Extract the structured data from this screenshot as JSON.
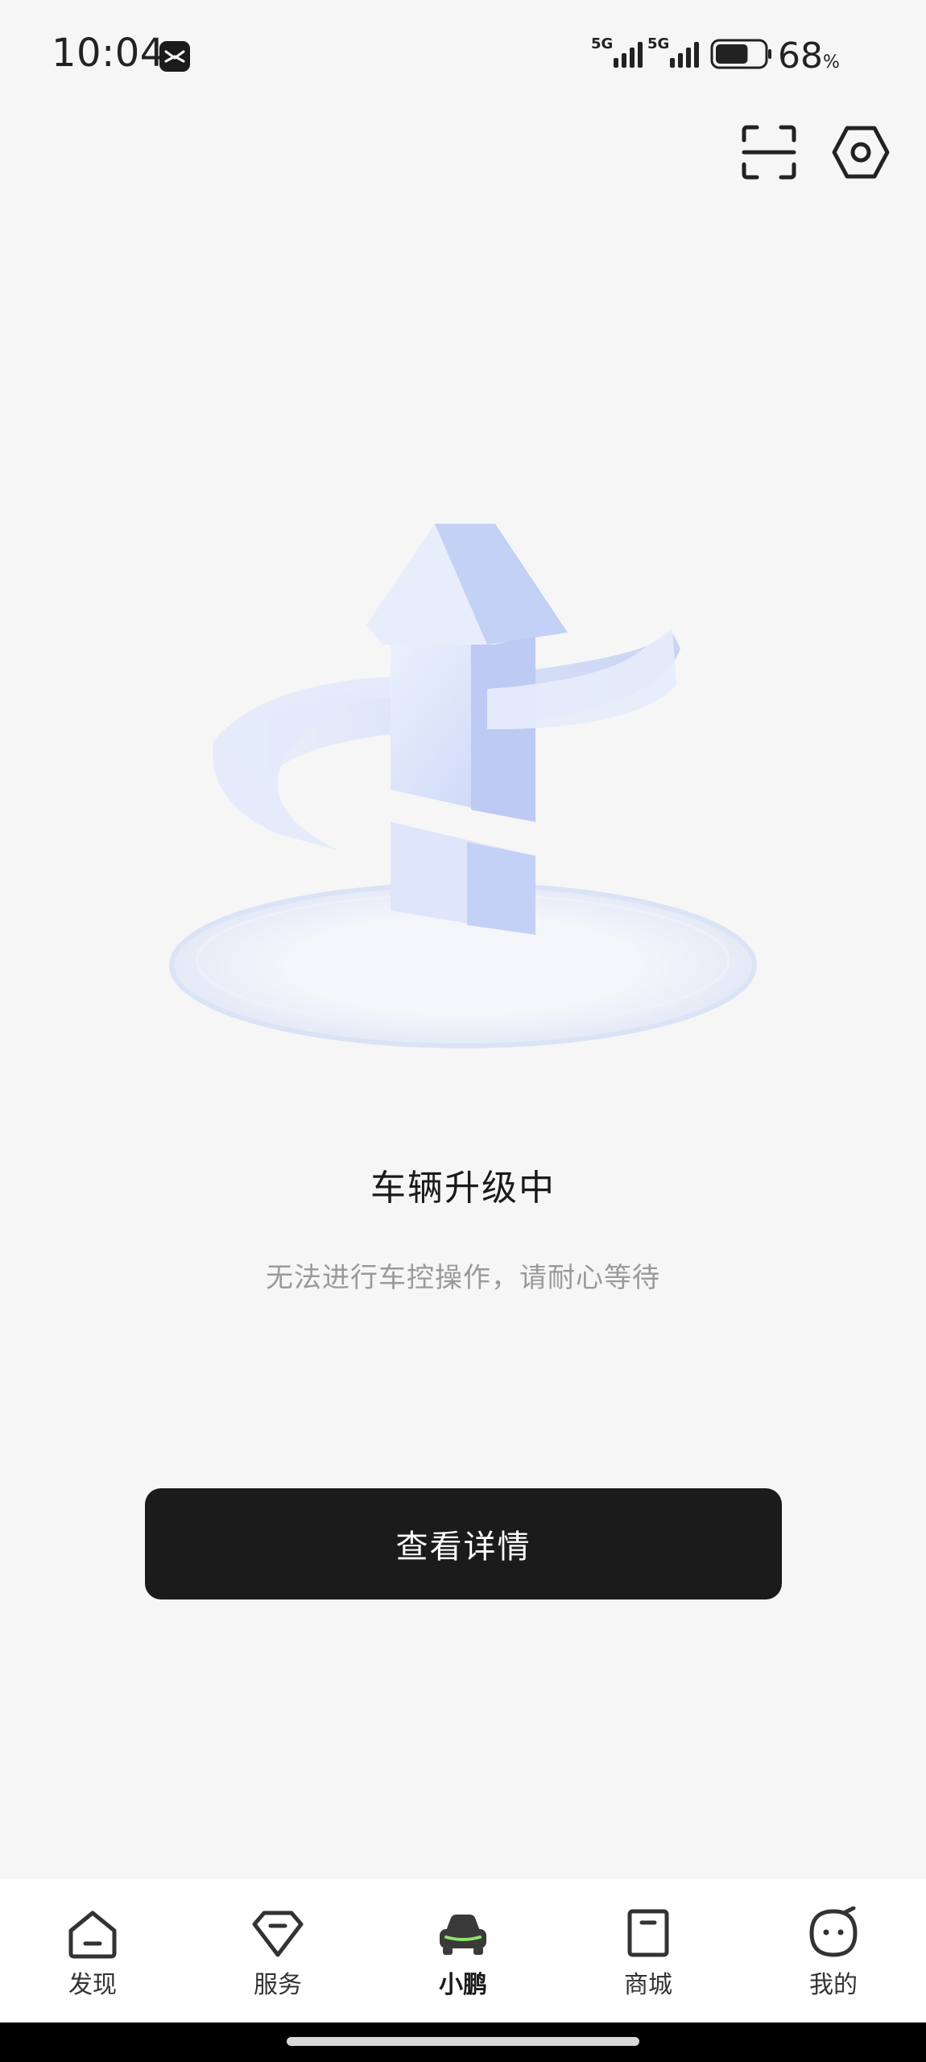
{
  "status_bar": {
    "time": "10:04",
    "app_icon": "xpeng-notification-icon",
    "network1": "5G",
    "network2": "5G",
    "battery_percent": "68",
    "battery_unit": "%",
    "battery_level": 0.68
  },
  "top_actions": {
    "scan_icon": "scan-icon",
    "settings_icon": "hexagon-settings-icon"
  },
  "status": {
    "title": "车辆升级中",
    "message": "无法进行车控操作，请耐心等待",
    "button_label": "查看详情"
  },
  "tabs": [
    {
      "label": "发现",
      "icon": "discover-icon",
      "active": false
    },
    {
      "label": "服务",
      "icon": "service-icon",
      "active": false
    },
    {
      "label": "小鹏",
      "icon": "car-icon",
      "active": true
    },
    {
      "label": "商城",
      "icon": "shop-bag-icon",
      "active": false
    },
    {
      "label": "我的",
      "icon": "profile-face-icon",
      "active": false
    }
  ],
  "colors": {
    "background": "#f6f6f6",
    "primary_button": "#1b1b1b",
    "accent_green": "#8fe36b",
    "illustration_blue": "#c9d6f8"
  }
}
